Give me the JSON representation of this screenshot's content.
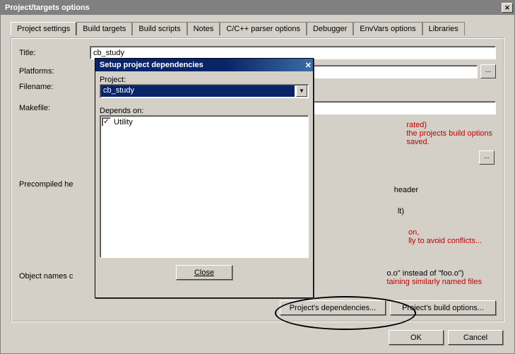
{
  "main": {
    "title": "Project/targets options",
    "tabs": [
      "Project settings",
      "Build targets",
      "Build scripts",
      "Notes",
      "C/C++ parser options",
      "Debugger",
      "EnvVars options",
      "Libraries"
    ],
    "active_tab_index": 0,
    "fields": {
      "title_label": "Title:",
      "title_value": "cb_study",
      "platforms_label": "Platforms:",
      "filename_label": "Filename:",
      "makefile_label": "Makefile:",
      "precompiled_label": "Precompiled he",
      "object_names_label": "Object names c",
      "browse_label": "..."
    },
    "warnings": {
      "line1": "rated)",
      "line2": "the projects build options",
      "line3": "saved.",
      "pch1": "header",
      "pch2": "lt)",
      "pch3a": "on,",
      "pch3b": "lly to avoid conflicts...",
      "obj1": "o.o\" instead of \"foo.o\")",
      "obj2": "taining similarly named files"
    },
    "buttons": {
      "deps": "Project's dependencies...",
      "build_opts": "Project's build options...",
      "ok": "OK",
      "cancel": "Cancel"
    }
  },
  "child": {
    "title": "Setup project dependencies",
    "project_label": "Project:",
    "project_value": "cb_study",
    "depends_label": "Depends on:",
    "items": [
      {
        "label": "Utility",
        "checked": true
      }
    ],
    "close_label": "Close"
  }
}
